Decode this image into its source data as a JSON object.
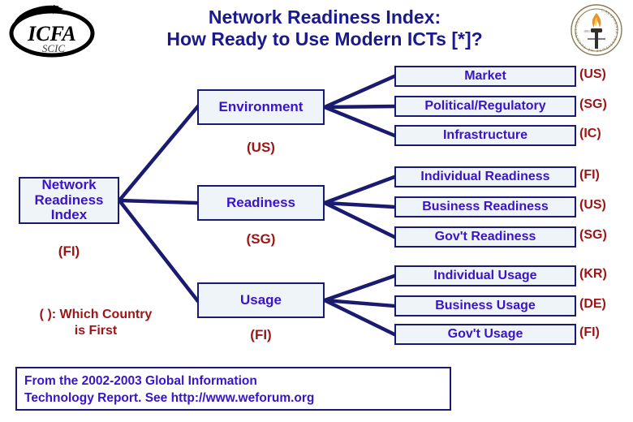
{
  "title": {
    "line1": "Network Readiness Index:",
    "line2": "How Ready to Use Modern ICTs [*]?"
  },
  "logos": {
    "icfa": {
      "name": "ICFA",
      "sub": "SCIC"
    },
    "caltech": {
      "name": "California Institute of Technology seal"
    }
  },
  "colors": {
    "title_blue": "#1a1a8c",
    "box_text_blue": "#3914c8",
    "box_border": "#1a1a70",
    "box_fill": "#eef4f7",
    "country_red": "#9e1414",
    "connector": "#1a1a70"
  },
  "root": {
    "label_line1": "Network",
    "label_line2": "Readiness",
    "label_line3": "Index",
    "country": "(FI)"
  },
  "branches": [
    {
      "label": "Environment",
      "country": "(US)",
      "children": [
        {
          "label": "Market",
          "country": "(US)"
        },
        {
          "label": "Political/Regulatory",
          "country": "(SG)"
        },
        {
          "label": "Infrastructure",
          "country": "(IC)"
        }
      ]
    },
    {
      "label": "Readiness",
      "country": "(SG)",
      "children": [
        {
          "label": "Individual Readiness",
          "country": "(FI)"
        },
        {
          "label": "Business Readiness",
          "country": "(US)"
        },
        {
          "label": "Gov't Readiness",
          "country": "(SG)"
        }
      ]
    },
    {
      "label": "Usage",
      "country": "(FI)",
      "children": [
        {
          "label": "Individual Usage",
          "country": "(KR)"
        },
        {
          "label": "Business Usage",
          "country": "(DE)"
        },
        {
          "label": "Gov't Usage",
          "country": "(FI)"
        }
      ]
    }
  ],
  "legend": {
    "line1": "(  ): Which Country",
    "line2": "is First"
  },
  "footer": {
    "line1": "From the 2002-2003 Global Information",
    "line2": "Technology Report.  See http://www.weforum.org"
  }
}
